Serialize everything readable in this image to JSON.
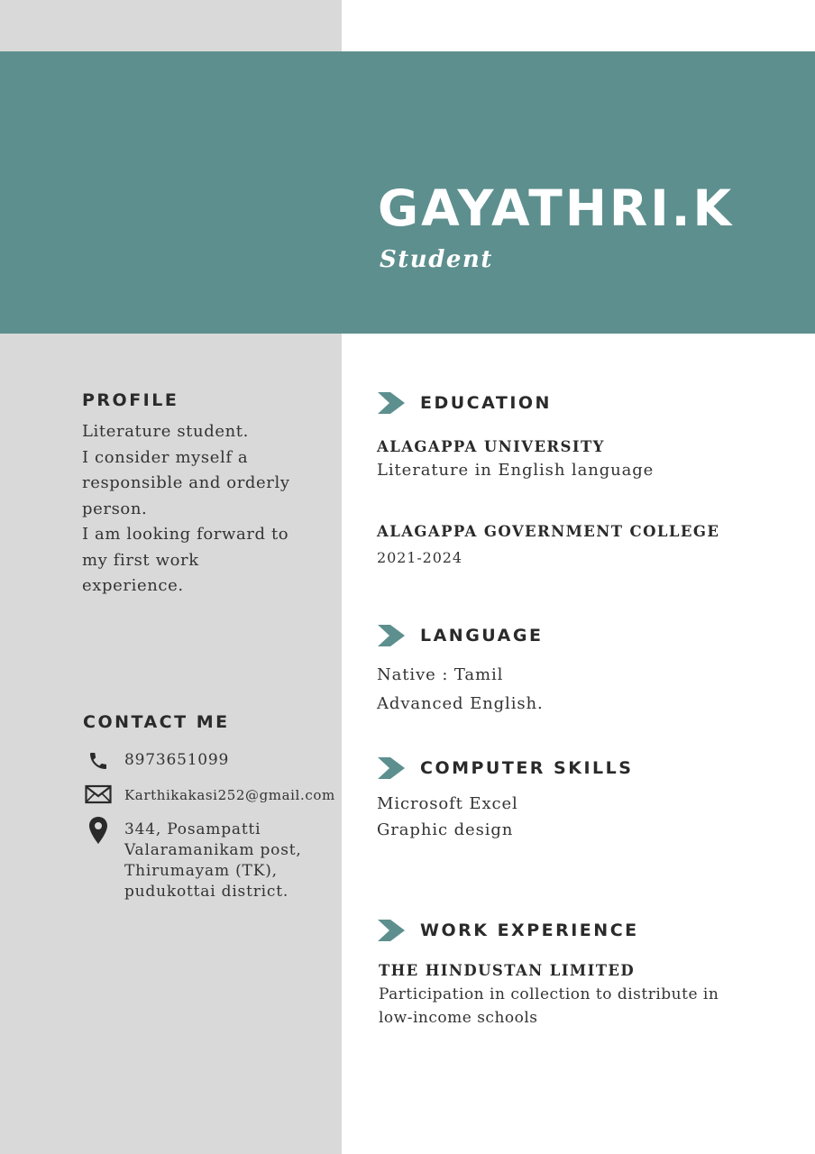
{
  "header": {
    "name": "GAYATHRI.K",
    "role": "Student"
  },
  "profile": {
    "heading": "PROFILE",
    "lines": [
      "Literature student.",
      "I consider myself a",
      "responsible and orderly",
      "person.",
      "I am looking forward to",
      "my first work",
      "experience."
    ]
  },
  "contact": {
    "heading": "CONTACT ME",
    "phone": "8973651099",
    "email": "Karthikakasi252@gmail.com",
    "address_lines": [
      "344, Posampatti",
      "Valaramanikam post,",
      "Thirumayam (TK),",
      "pudukottai district."
    ],
    "icons": {
      "phone": "phone-icon",
      "email": "envelope-icon",
      "address": "map-pin-icon"
    }
  },
  "education": {
    "heading": "EDUCATION",
    "entries": [
      {
        "title": "ALAGAPPA UNIVERSITY",
        "detail": "Literature in English language"
      },
      {
        "title": "ALAGAPPA GOVERNMENT COLLEGE",
        "detail": "2021-2024"
      }
    ]
  },
  "language": {
    "heading": "LANGUAGE",
    "items": [
      "Native : Tamil",
      "Advanced English."
    ]
  },
  "computer_skills": {
    "heading": "COMPUTER SKILLS",
    "items": [
      "Microsoft Excel",
      "Graphic design"
    ]
  },
  "work_experience": {
    "heading": "WORK EXPERIENCE",
    "company": "THE HINDUSTAN LIMITED",
    "description_lines": [
      "Participation in collection to distribute in",
      "low-income schools"
    ]
  },
  "colors": {
    "accent": "#5d8f8e",
    "sidebar": "#d9d9d9",
    "heading_text": "#2a2a2a"
  }
}
